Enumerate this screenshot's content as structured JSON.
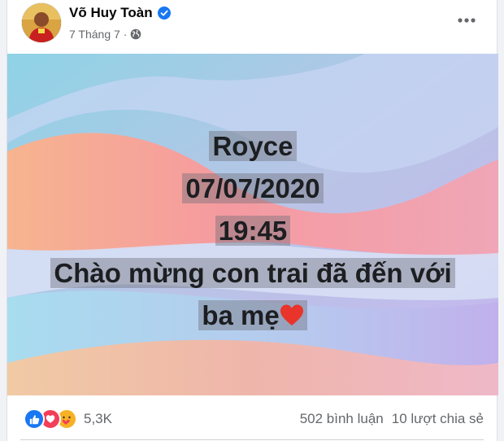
{
  "post": {
    "author": {
      "name": "Võ Huy Toàn",
      "verified_icon": "verified-badge-icon",
      "avatar_icon": "avatar"
    },
    "meta": {
      "date": "7 Tháng 7",
      "separator": "·",
      "audience_icon": "globe-icon"
    },
    "more_icon": "more-options-icon",
    "caption": {
      "lines": [
        "Royce",
        "07/07/2020",
        "19:45",
        "Chào mừng con trai đã đến với",
        "ba mẹ"
      ],
      "heart_icon": "heart-emoji-icon"
    },
    "footer": {
      "reaction_icons": [
        "like-icon",
        "love-icon",
        "care-icon"
      ],
      "reaction_count": "5,3K",
      "comments": "502 bình luận",
      "shares": "10 lượt chia sẻ"
    }
  },
  "colors": {
    "like": "#1877f2",
    "love": "#f33e58",
    "care": "#f7b125",
    "verified": "#1877f2"
  }
}
